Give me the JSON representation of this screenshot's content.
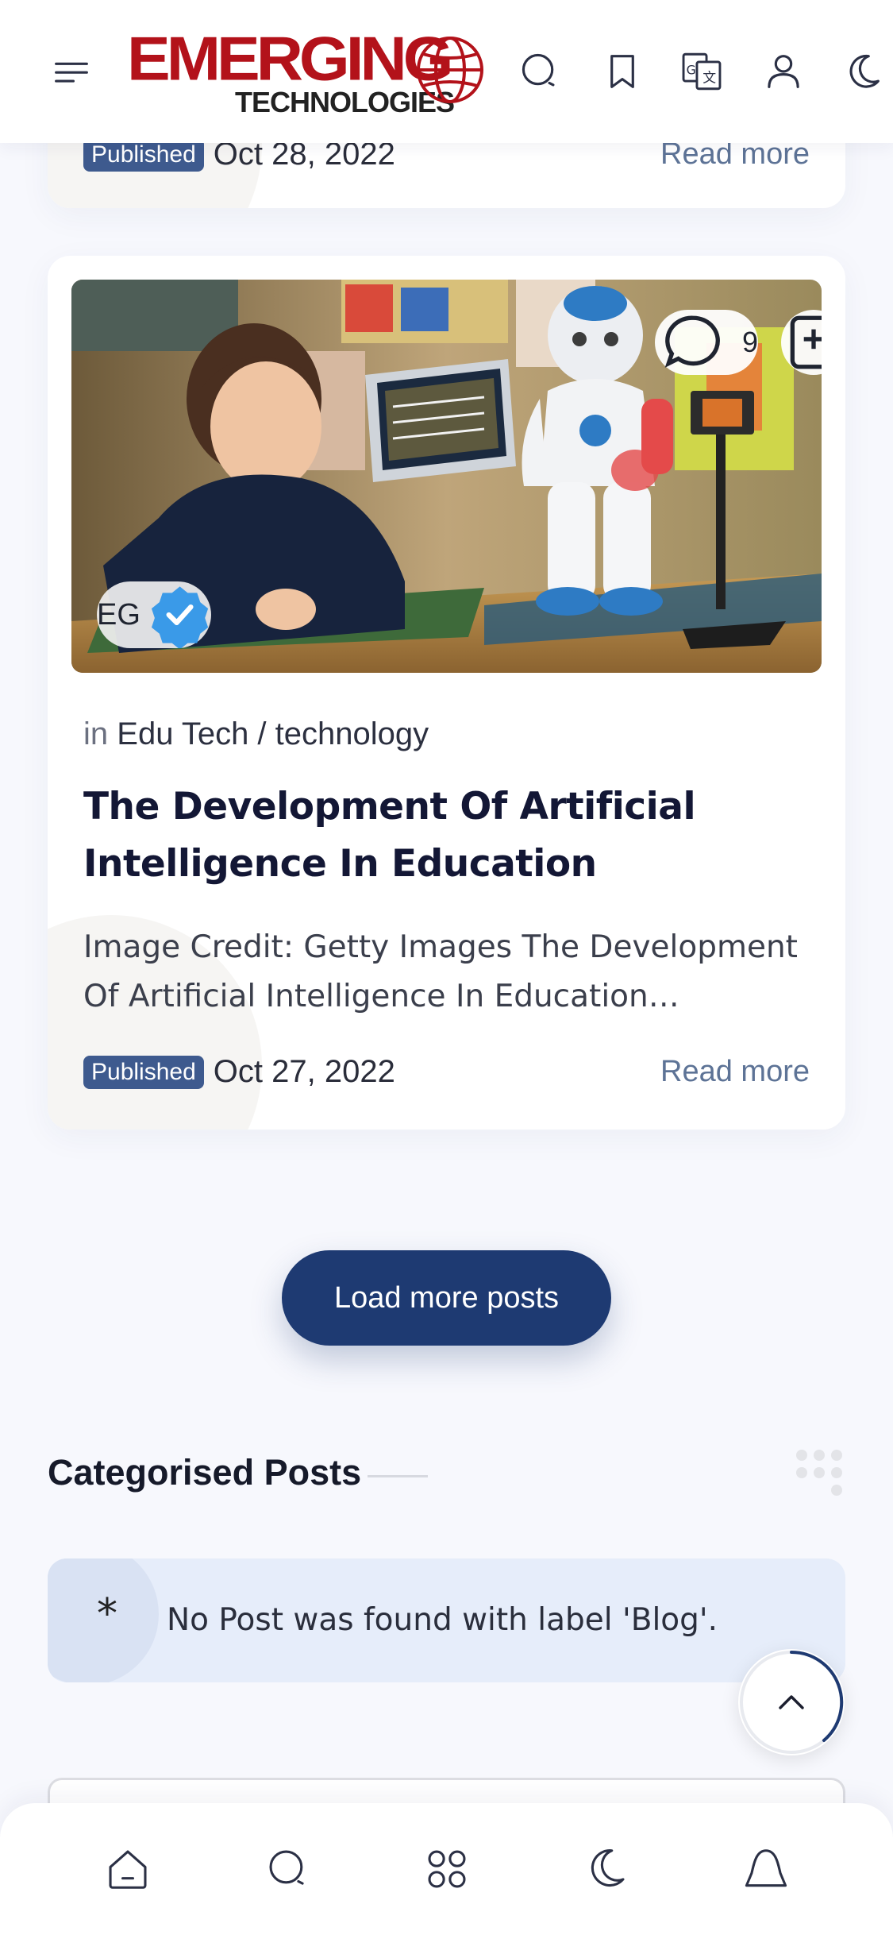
{
  "header": {
    "logo_main": "EMERGING",
    "logo_sub": "TECHNOLOGIES",
    "icons": [
      "menu-icon",
      "search-icon",
      "bookmark-icon",
      "translate-icon",
      "user-icon",
      "dark-mode-icon"
    ]
  },
  "posts": [
    {
      "published_label": "Published",
      "date": "Oct 28, 2022",
      "read_more": "Read more"
    },
    {
      "comments": "9",
      "author_initials": "EG",
      "category_prefix": "in",
      "categories": "Edu Tech / technology",
      "title": "The Development Of Artificial Intelligence In Education",
      "excerpt": "Image Credit: Getty Images The Development Of Artificial Intelligence In Education…",
      "published_label": "Published",
      "date": "Oct 27, 2022",
      "read_more": "Read more"
    }
  ],
  "load_more": "Load more posts",
  "categorised": {
    "title": "Categorised Posts",
    "notice_symbol": "*",
    "notice": "No Post was found with label 'Blog'."
  },
  "bottom_nav": [
    "home-icon",
    "search-icon",
    "apps-icon",
    "dark-mode-icon",
    "bell-icon"
  ],
  "colors": {
    "brand_red": "#b3121a",
    "accent_navy": "#1e3a72",
    "badge_blue": "#3e5a8e",
    "link": "#5d7396",
    "background": "#f7f8fd",
    "notice_bg": "#e6edfa"
  }
}
